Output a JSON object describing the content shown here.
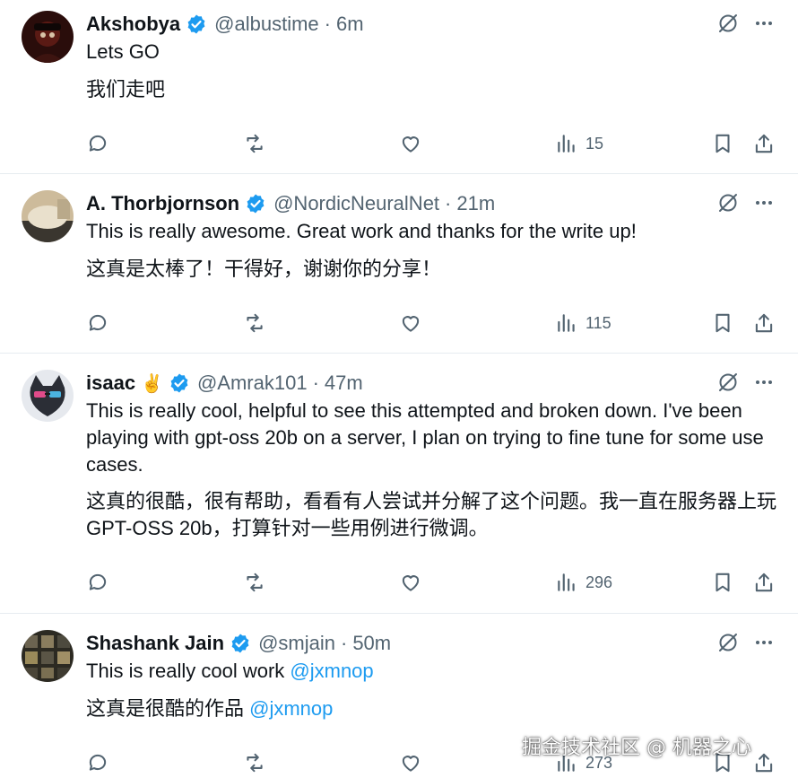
{
  "colors": {
    "text": "#0f1419",
    "secondary": "#536471",
    "accent": "#1d9bf0",
    "divider": "#e6ecf0",
    "verified": "#1d9bf0"
  },
  "posts": [
    {
      "name": "Akshobya",
      "handle": "@albustime",
      "dot": "·",
      "time": "6m",
      "line1": "Lets GO",
      "translation": "我们走吧",
      "views": "15"
    },
    {
      "name": "A. Thorbjornson",
      "handle": "@NordicNeuralNet",
      "dot": "·",
      "time": "21m",
      "line1": "This is really awesome. Great work and thanks for the write up!",
      "translation": "这真是太棒了！干得好，谢谢你的分享！",
      "views": "115"
    },
    {
      "name": "isaac",
      "emoji": "✌️",
      "handle": "@Amrak101",
      "dot": "·",
      "time": "47m",
      "line1": "This is really cool, helpful to see this attempted and broken down. I've been playing with gpt-oss 20b on a server,  I plan on trying to fine tune for some use cases.",
      "translation": "这真的很酷，很有帮助，看看有人尝试并分解了这个问题。我一直在服务器上玩 GPT-OSS 20b，打算针对一些用例进行微调。",
      "views": "296"
    },
    {
      "name": "Shashank Jain",
      "handle": "@smjain",
      "dot": "·",
      "time": "50m",
      "line1_text": "This is really cool work ",
      "line1_mention": "@jxmnop",
      "translation_text": "这真是很酷的作品 ",
      "translation_mention": "@jxmnop",
      "views": "273"
    }
  ],
  "watermark": "掘金技术社区 @ 机器之心"
}
